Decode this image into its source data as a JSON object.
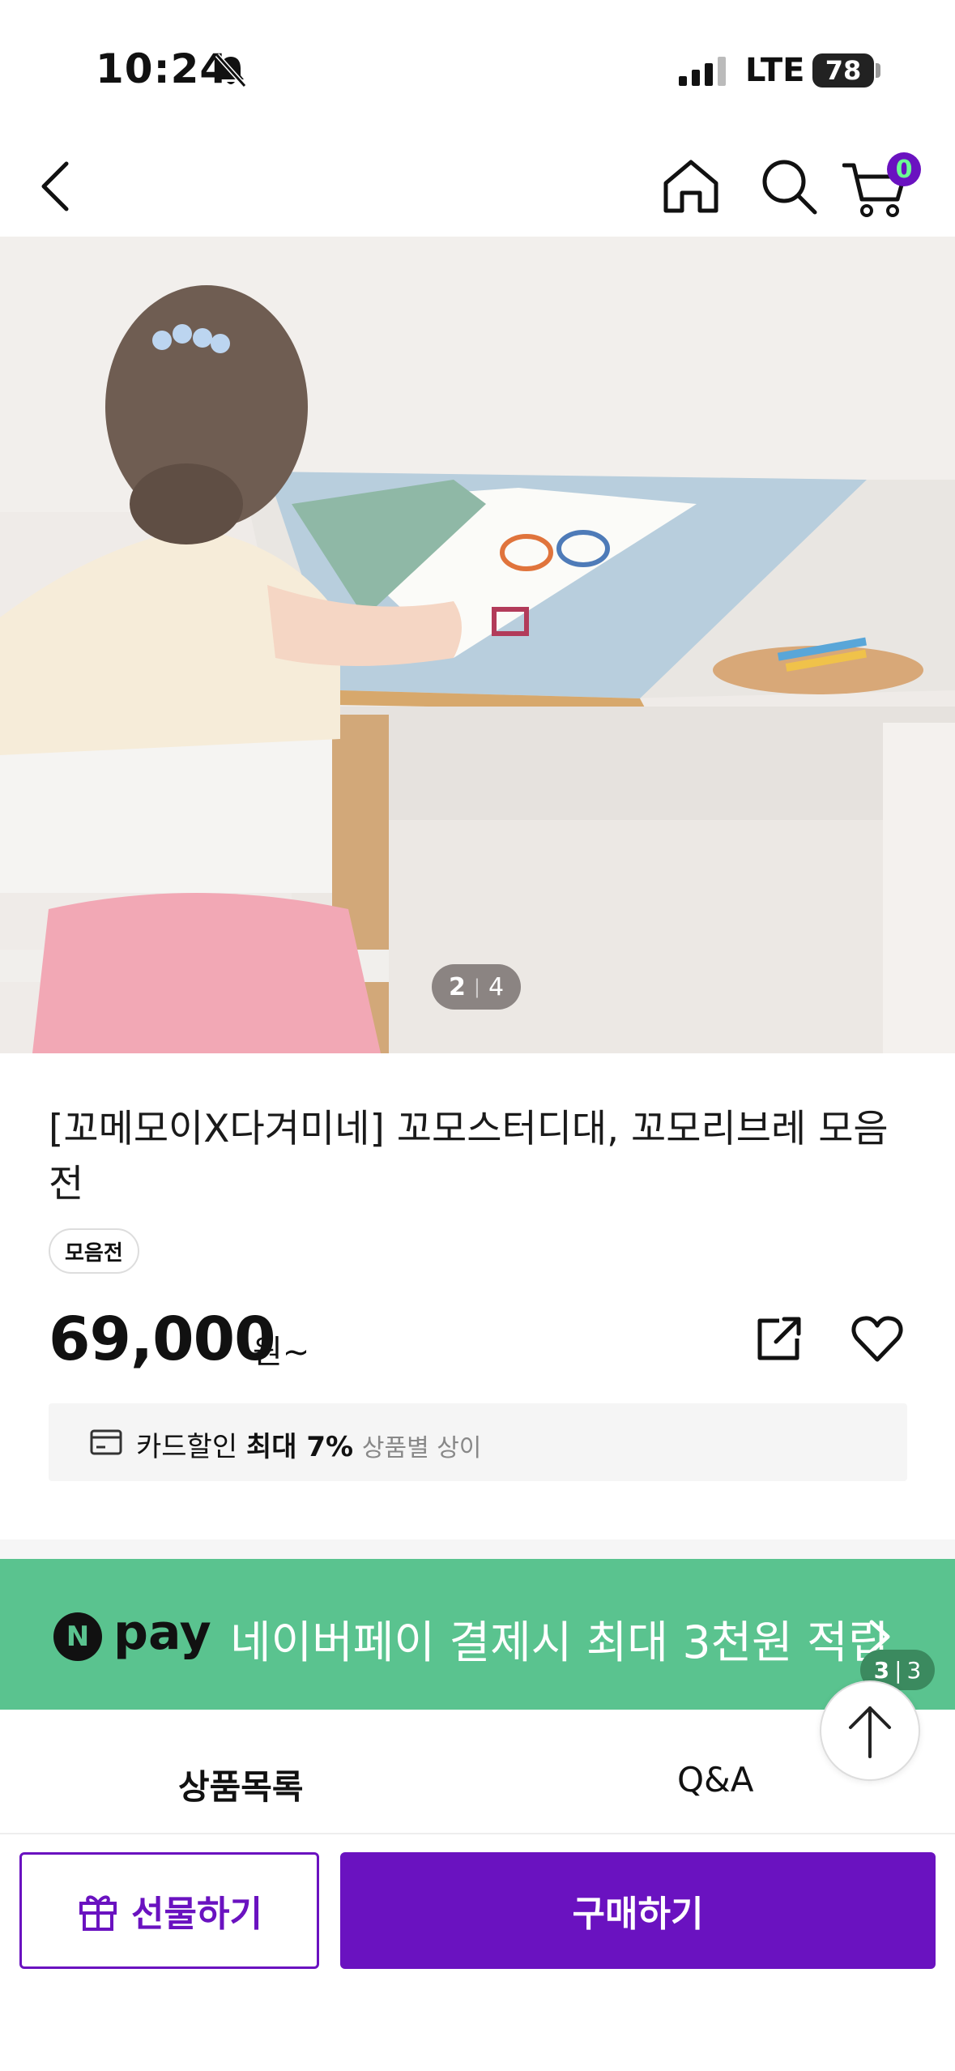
{
  "status_bar": {
    "time": "10:24",
    "network": "LTE",
    "battery": "78"
  },
  "nav": {
    "cart_count": "0",
    "icons": [
      "back-icon",
      "home-icon",
      "search-icon",
      "cart-icon"
    ]
  },
  "hero": {
    "current_image": "2",
    "total_images": "4"
  },
  "product": {
    "title": "[꼬메모이X다겨미네] 꼬모스터디대, 꼬모리브레 모음전",
    "tag": "모음전",
    "price": "69,000",
    "price_unit": "원~"
  },
  "discount": {
    "label": "카드할인",
    "highlight": "최대 7%",
    "note": "상품별 상이"
  },
  "npay_banner": {
    "logo_letter": "N",
    "logo_word": "pay",
    "text": "네이버페이 결제시 최대 3천원 적립",
    "current": "3",
    "total": "3",
    "color": "#5ac38f"
  },
  "tabs": [
    {
      "label": "상품목록",
      "active": true
    },
    {
      "label": "Q&A",
      "active": false
    }
  ],
  "actions": {
    "gift_label": "선물하기",
    "buy_label": "구매하기",
    "accent_color": "#6a12c0"
  }
}
